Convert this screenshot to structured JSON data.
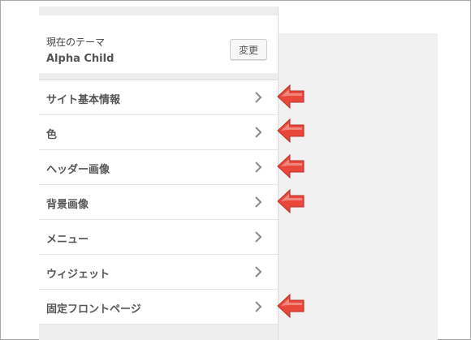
{
  "theme": {
    "label": "現在のテーマ",
    "name": "Alpha Child",
    "change_label": "変更"
  },
  "menu": {
    "items": [
      {
        "label": "サイト基本情報",
        "highlighted": true
      },
      {
        "label": "色",
        "highlighted": true
      },
      {
        "label": "ヘッダー画像",
        "highlighted": true
      },
      {
        "label": "背景画像",
        "highlighted": true
      },
      {
        "label": "メニュー",
        "highlighted": false
      },
      {
        "label": "ウィジェット",
        "highlighted": false
      },
      {
        "label": "固定フロントページ",
        "highlighted": true
      }
    ]
  },
  "icons": {
    "item_chevron": "chevron-right-icon",
    "annotation": "red-arrow-left-icon"
  },
  "colors": {
    "arrow_red": "#e8473a",
    "panel_bg": "#eeeeee",
    "preview_bg": "#f1f1f1",
    "text": "#555555"
  }
}
